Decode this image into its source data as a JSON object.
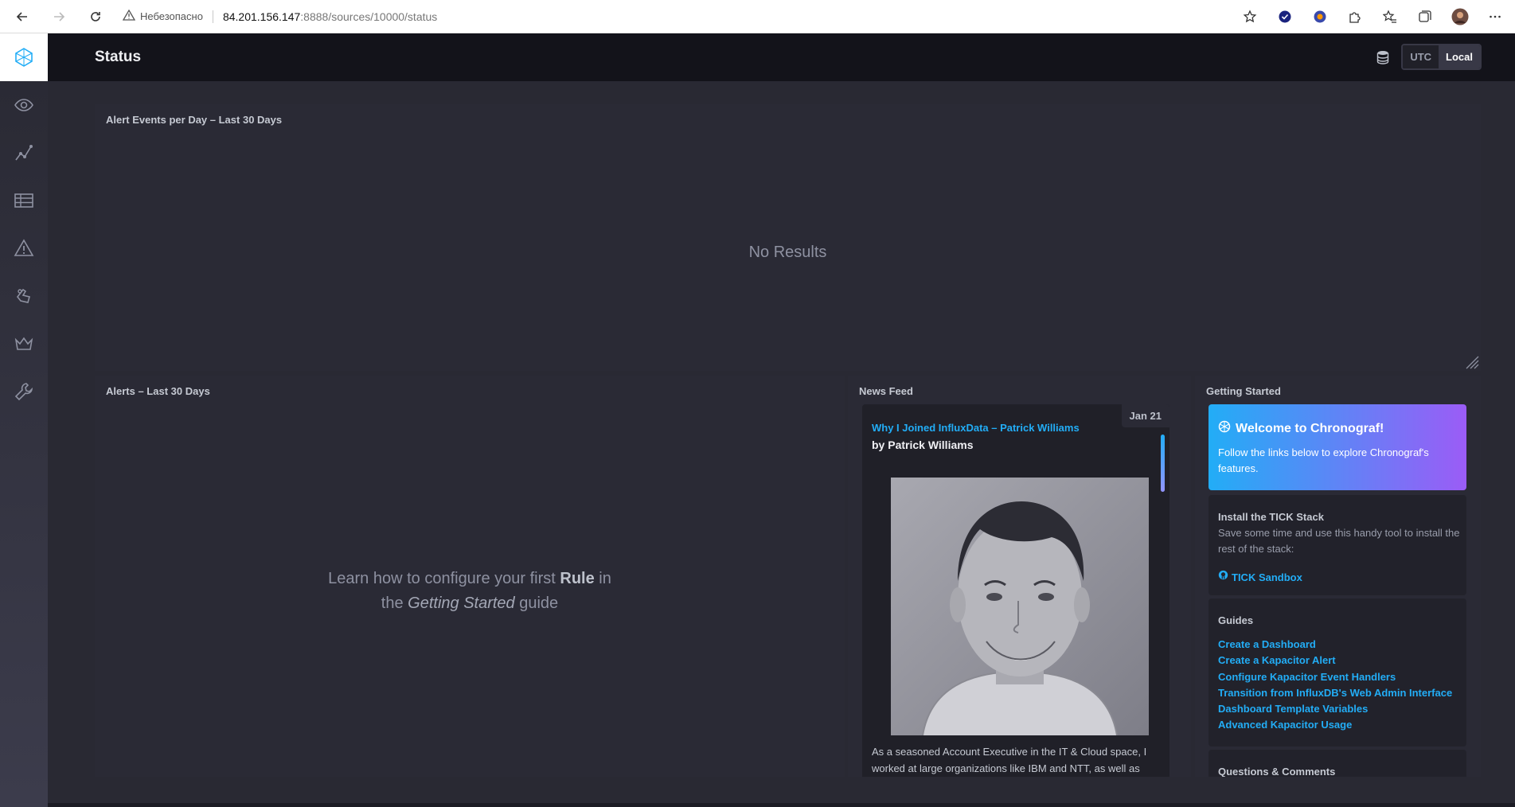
{
  "browser": {
    "security_label": "Небезопасно",
    "url_host": "84.201.156.147",
    "url_path": ":8888/sources/10000/status"
  },
  "header": {
    "title": "Status",
    "tz_utc": "UTC",
    "tz_local": "Local",
    "tz_selected": "Local"
  },
  "sidebar": {
    "items": [
      "logo",
      "host-list",
      "data-explorer",
      "dashboards",
      "alerting",
      "log-viewer",
      "admin",
      "configuration"
    ]
  },
  "alert_events": {
    "title": "Alert Events per Day – Last 30 Days",
    "empty_text": "No Results"
  },
  "alerts": {
    "title": "Alerts – Last 30 Days",
    "msg_part1": "Learn how to configure your first ",
    "msg_rule": "Rule",
    "msg_part2": " in",
    "msg_part3": "the ",
    "msg_guide": "Getting Started",
    "msg_part4": " guide"
  },
  "news": {
    "title": "News Feed",
    "date": "Jan 21",
    "article_title": "Why I Joined InfluxData – Patrick Williams",
    "author": "by Patrick Williams",
    "excerpt": "As a seasoned Account Executive in the IT & Cloud space, I worked at large organizations like IBM and NTT, as well as"
  },
  "getting_started": {
    "title": "Getting Started",
    "welcome_title": "Welcome to Chronograf!",
    "welcome_text": "Follow the links below to explore Chronograf's features.",
    "install_title": "Install the TICK Stack",
    "install_text": "Save some time and use this handy tool to install the rest of the stack:",
    "sandbox_link": "TICK Sandbox",
    "guides_title": "Guides",
    "guides": [
      "Create a Dashboard",
      "Create a Kapacitor Alert",
      "Configure Kapacitor Event Handlers",
      "Transition from InfluxDB's Web Admin Interface",
      "Dashboard Template Variables",
      "Advanced Kapacitor Usage"
    ],
    "questions_title": "Questions & Comments"
  },
  "colors": {
    "accent": "#22adf6",
    "background": "#292933",
    "header": "#13131a"
  }
}
